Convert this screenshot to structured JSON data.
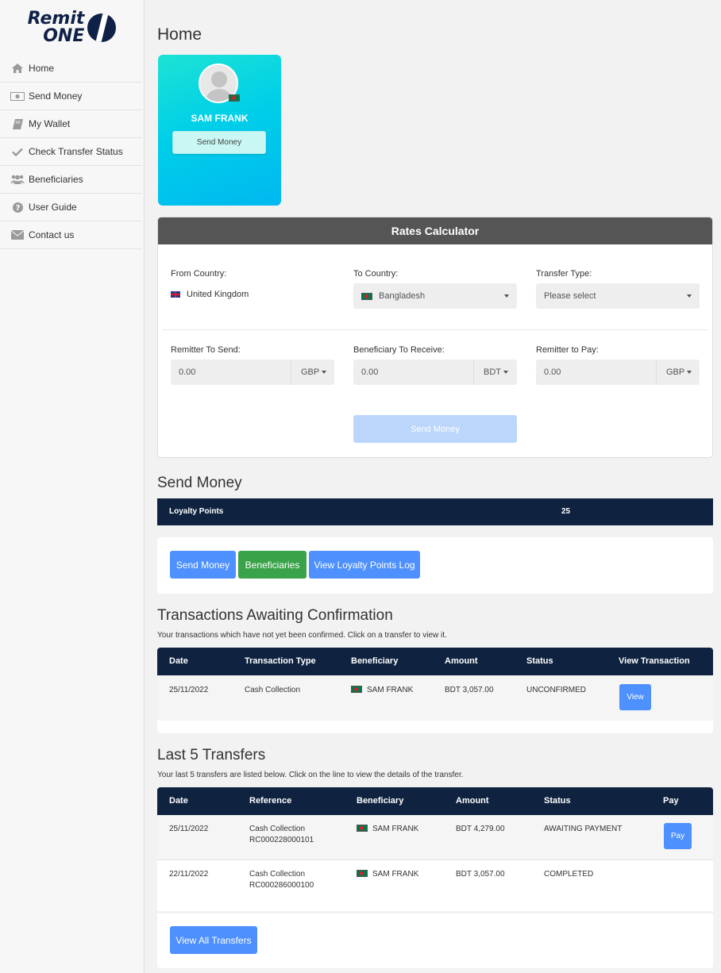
{
  "brand": {
    "line1": "Remit",
    "line2": "ONE"
  },
  "sidebar": {
    "items": [
      {
        "label": "Home",
        "icon": "home-icon"
      },
      {
        "label": "Send Money",
        "icon": "money-icon"
      },
      {
        "label": "My Wallet",
        "icon": "book-icon"
      },
      {
        "label": "Check Transfer Status",
        "icon": "check-icon"
      },
      {
        "label": "Beneficiaries",
        "icon": "users-icon"
      },
      {
        "label": "User Guide",
        "icon": "question-icon"
      },
      {
        "label": "Contact us",
        "icon": "envelope-icon"
      }
    ]
  },
  "page": {
    "title": "Home"
  },
  "profile": {
    "name": "SAM FRANK",
    "button": "Send Money"
  },
  "calculator": {
    "title": "Rates Calculator",
    "from_label": "From Country:",
    "from_value": "United Kingdom",
    "to_label": "To Country:",
    "to_value": "Bangladesh",
    "type_label": "Transfer Type:",
    "type_placeholder": "Please select",
    "send_label": "Remitter To Send:",
    "send_value": "0.00",
    "send_currency": "GBP",
    "receive_label": "Beneficiary To Receive:",
    "receive_value": "0.00",
    "receive_currency": "BDT",
    "pay_label": "Remitter to Pay:",
    "pay_value": "0.00",
    "pay_currency": "GBP",
    "submit": "Send Money"
  },
  "send_money": {
    "title": "Send Money",
    "loyalty_label": "Loyalty Points",
    "loyalty_value": "25",
    "buttons": {
      "send": "Send Money",
      "beneficiaries": "Beneficiaries",
      "loyalty_log": "View Loyalty Points Log"
    }
  },
  "awaiting": {
    "title": "Transactions Awaiting Confirmation",
    "subtitle": "Your transactions which have not yet been confirmed. Click on a transfer to view it.",
    "columns": [
      "Date",
      "Transaction Type",
      "Beneficiary",
      "Amount",
      "Status",
      "View Transaction"
    ],
    "rows": [
      {
        "date": "25/11/2022",
        "type": "Cash Collection",
        "beneficiary": "SAM FRANK",
        "amount": "BDT 3,057.00",
        "status": "UNCONFIRMED",
        "action": "View"
      }
    ]
  },
  "last5": {
    "title": "Last 5 Transfers",
    "subtitle": "Your last 5 transfers are listed below. Click on the line to view the details of the transfer.",
    "columns": [
      "Date",
      "Reference",
      "Beneficiary",
      "Amount",
      "Status",
      "Pay"
    ],
    "rows": [
      {
        "date": "25/11/2022",
        "ref_type": "Cash Collection",
        "ref_no": "RC000228000101",
        "beneficiary": "SAM FRANK",
        "amount": "BDT 4,279.00",
        "status": "AWAITING PAYMENT",
        "action": "Pay"
      },
      {
        "date": "22/11/2022",
        "ref_type": "Cash Collection",
        "ref_no": "RC000286000100",
        "beneficiary": "SAM FRANK",
        "amount": "BDT 3,057.00",
        "status": "COMPLETED",
        "action": ""
      }
    ],
    "view_all": "View All Transfers"
  },
  "colors": {
    "navy": "#0f2340",
    "primary": "#4d90fe",
    "success": "#3aa34a",
    "calc_header": "#555555"
  }
}
